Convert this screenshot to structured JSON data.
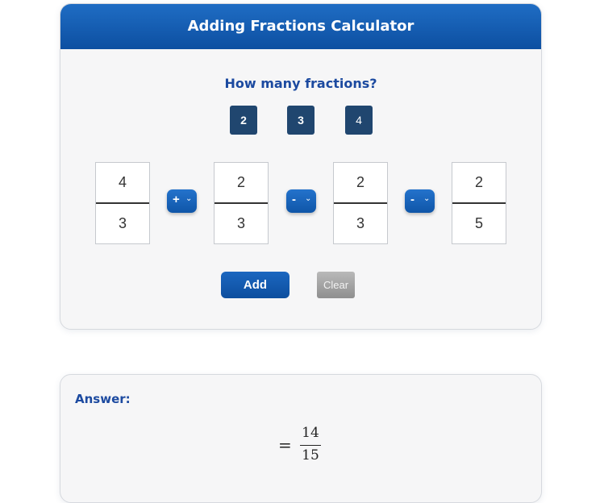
{
  "header": {
    "title": "Adding Fractions Calculator"
  },
  "prompt": "How many fractions?",
  "count_options": [
    {
      "label": "2"
    },
    {
      "label": "3"
    },
    {
      "label": "4"
    }
  ],
  "fractions": [
    {
      "numerator": "4",
      "denominator": "3"
    },
    {
      "numerator": "2",
      "denominator": "3"
    },
    {
      "numerator": "2",
      "denominator": "3"
    },
    {
      "numerator": "2",
      "denominator": "5"
    }
  ],
  "operators": [
    {
      "symbol": "+"
    },
    {
      "symbol": "-"
    },
    {
      "symbol": "-"
    }
  ],
  "buttons": {
    "add": "Add",
    "clear": "Clear"
  },
  "answer": {
    "label": "Answer:",
    "equals": "=",
    "numerator": "14",
    "denominator": "15"
  },
  "colors": {
    "accent": "#0d4fa1",
    "heading_text": "#1c4aa0",
    "count_button": "#20466f",
    "clear_button": "#9e9e9e"
  },
  "icons": {
    "operator_dropdown": "chevron-down-icon"
  }
}
